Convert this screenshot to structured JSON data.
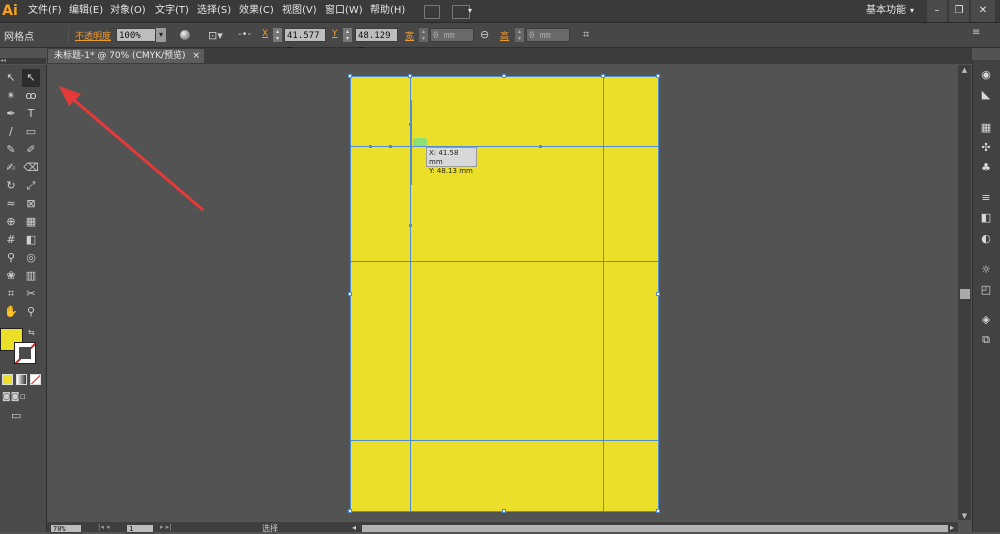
{
  "app": {
    "logo": "Ai"
  },
  "menu": [
    "文件(F)",
    "编辑(E)",
    "对象(O)",
    "文字(T)",
    "选择(S)",
    "效果(C)",
    "视图(V)",
    "窗口(W)",
    "帮助(H)"
  ],
  "workspace": "基本功能",
  "control": {
    "object_label": "网格点",
    "opacity_label": "不透明度",
    "opacity_value": "100%",
    "x_label": "X",
    "x_value": "41.577 m",
    "y_label": "Y",
    "y_value": "48.129 m",
    "w_label": "宽",
    "w_value": "0 mm",
    "h_label": "高",
    "h_value": "0 mm"
  },
  "document_tab": {
    "title": "未标题-1* @ 70% (CMYK/预览)",
    "close": "×"
  },
  "tooltip": {
    "x": "X: 41.58 mm",
    "y": "Y: 48.13 mm"
  },
  "status": {
    "zoom": "70%",
    "page": "1",
    "mode": "选择"
  },
  "colors": {
    "fill": "#ecdf2a",
    "mesh": "#4f8cd3",
    "arrow": "#e63a3a"
  },
  "tools_icons": [
    "selection-icon",
    "direct-selection-icon",
    "magic-wand-icon",
    "lasso-icon",
    "pen-icon",
    "type-icon",
    "line-icon",
    "rectangle-icon",
    "paintbrush-icon",
    "pencil-icon",
    "blob-brush-icon",
    "eraser-icon",
    "rotate-icon",
    "scale-icon",
    "warp-icon",
    "free-transform-icon",
    "shape-builder-icon",
    "perspective-icon",
    "mesh-icon",
    "gradient-icon",
    "eyedropper-icon",
    "blend-icon",
    "symbol-sprayer-icon",
    "graph-icon",
    "artboard-icon",
    "slice-icon",
    "hand-icon",
    "zoom-icon"
  ]
}
